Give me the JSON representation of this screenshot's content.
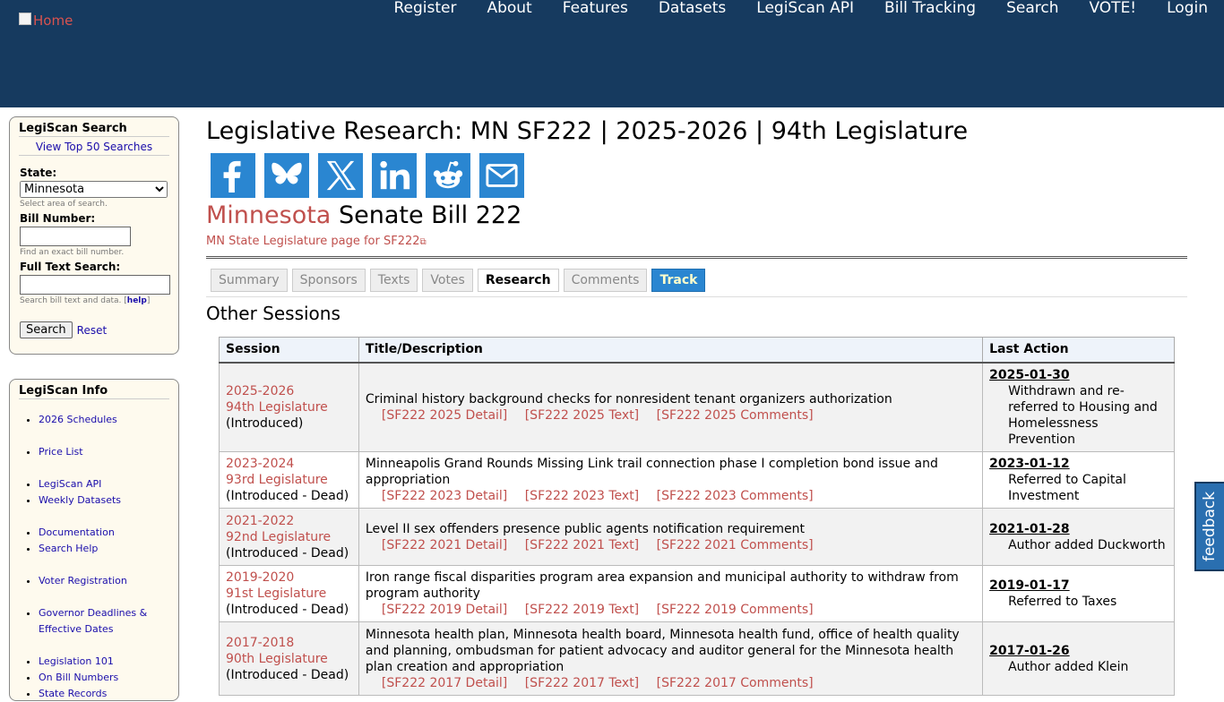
{
  "header": {
    "logo_alt": "Home",
    "nav": [
      "Register",
      "About",
      "Features",
      "Datasets",
      "LegiScan API",
      "Bill Tracking",
      "Search",
      "VOTE!",
      "Login"
    ]
  },
  "sidebar": {
    "search": {
      "title": "LegiScan Search",
      "top50": "View Top 50 Searches",
      "state_label": "State:",
      "state_value": "Minnesota",
      "state_hint": "Select area of search.",
      "bill_label": "Bill Number:",
      "bill_hint": "Find an exact bill number.",
      "full_label": "Full Text Search:",
      "full_hint": "Search bill text and data.",
      "help": "help",
      "search_btn": "Search",
      "reset": "Reset"
    },
    "info": {
      "title": "LegiScan Info",
      "items": [
        "2026 Schedules",
        "Price List",
        "LegiScan API",
        "Weekly Datasets",
        "Documentation",
        "Search Help",
        "Voter Registration",
        "Governor Deadlines & Effective Dates",
        "Legislation 101",
        "On Bill Numbers",
        "State Records"
      ]
    }
  },
  "main": {
    "title": "Legislative Research: MN SF222 | 2025-2026 | 94th Legislature",
    "share_icons": [
      "facebook-icon",
      "bluesky-icon",
      "x-icon",
      "linkedin-icon",
      "reddit-icon",
      "email-icon"
    ],
    "bill_state": "Minnesota",
    "bill_name": "Senate Bill 222",
    "state_link": "MN State Legislature page for SF222",
    "tabs": [
      "Summary",
      "Sponsors",
      "Texts",
      "Votes",
      "Research",
      "Comments",
      "Track"
    ],
    "active_tab": "Research",
    "other_sessions": "Other Sessions",
    "table": {
      "headers": [
        "Session",
        "Title/Description",
        "Last Action"
      ],
      "rows": [
        {
          "year": "2025-2026",
          "leg": "94th Legislature",
          "status": "(Introduced)",
          "title": "Criminal history background checks for nonresident tenant organizers authorization",
          "links": [
            "[SF222 2025 Detail]",
            "[SF222 2025 Text]",
            "[SF222 2025 Comments]"
          ],
          "date": "2025-01-30",
          "action": "Withdrawn and re-referred to Housing and Homelessness Prevention"
        },
        {
          "year": "2023-2024",
          "leg": "93rd Legislature",
          "status": "(Introduced - Dead)",
          "title": "Minneapolis Grand Rounds Missing Link trail connection phase I completion bond issue and appropriation",
          "links": [
            "[SF222 2023 Detail]",
            "[SF222 2023 Text]",
            "[SF222 2023 Comments]"
          ],
          "date": "2023-01-12",
          "action": "Referred to Capital Investment"
        },
        {
          "year": "2021-2022",
          "leg": "92nd Legislature",
          "status": "(Introduced - Dead)",
          "title": "Level II sex offenders presence public agents notification requirement",
          "links": [
            "[SF222 2021 Detail]",
            "[SF222 2021 Text]",
            "[SF222 2021 Comments]"
          ],
          "date": "2021-01-28",
          "action": "Author added Duckworth"
        },
        {
          "year": "2019-2020",
          "leg": "91st Legislature",
          "status": "(Introduced - Dead)",
          "title": "Iron range fiscal disparities program area expansion and municipal authority to withdraw from program authority",
          "links": [
            "[SF222 2019 Detail]",
            "[SF222 2019 Text]",
            "[SF222 2019 Comments]"
          ],
          "date": "2019-01-17",
          "action": "Referred to Taxes"
        },
        {
          "year": "2017-2018",
          "leg": "90th Legislature",
          "status": "(Introduced - Dead)",
          "title": "Minnesota health plan, Minnesota health board, Minnesota health fund, office of health quality and planning, ombudsman for patient advocacy and auditor general for the Minnesota health plan creation and appropriation",
          "links": [
            "[SF222 2017 Detail]",
            "[SF222 2017 Text]",
            "[SF222 2017 Comments]"
          ],
          "date": "2017-01-26",
          "action": "Author added Klein"
        }
      ]
    }
  },
  "feedback": "feedback",
  "colors": {
    "header_bg": "#163a5f",
    "link_red": "#c0504d",
    "share_blue": "#2a86d1",
    "sidebar_bg": "#fefaee"
  }
}
